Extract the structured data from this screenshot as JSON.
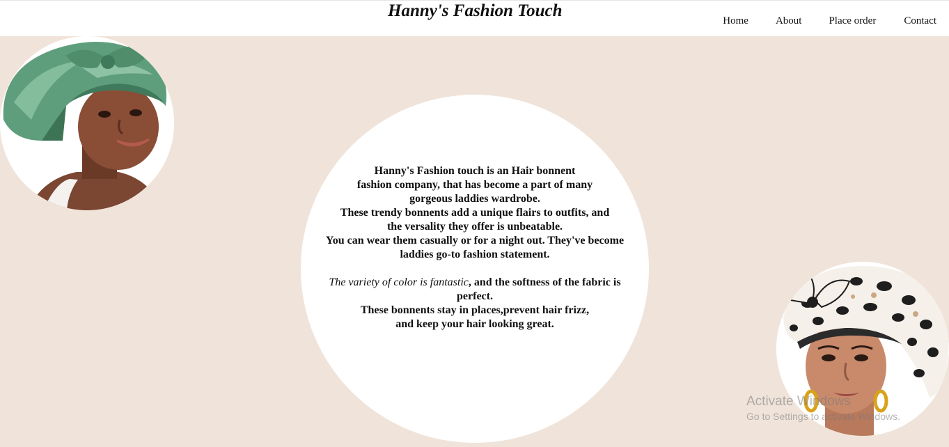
{
  "header": {
    "brand": "Hanny's Fashion Touch",
    "nav": {
      "home": "Home",
      "about": "About",
      "place_order": "Place order",
      "contact": "Contact"
    }
  },
  "about": {
    "lines_1": [
      "Hanny's Fashion touch is an Hair bonnent",
      "fashion company, that has become a part of many",
      "gorgeous laddies wardrobe.",
      "These trendy bonnents add a unique flairs to outfits, and",
      "the versality they offer is unbeatable.",
      "You can wear them casually or for a night out. They've become",
      "laddies go-to fashion statement."
    ],
    "italic_part": "The variety of color is fantastic",
    "after_italic": ", and the softness of the fabric is",
    "lines_2": [
      "perfect.",
      "These bonnents stay in places,prevent hair frizz,",
      "and keep your hair looking great."
    ]
  },
  "images": {
    "left_icon": "woman-green-satin-bonnet-photo",
    "right_icon": "woman-leopard-print-bonnet-photo"
  },
  "watermark": {
    "title": "Activate Windows",
    "subtitle": "Go to Settings to activate Windows."
  },
  "colors": {
    "page_background": "#f0e4da",
    "header_background": "#ffffff",
    "text": "#111111"
  }
}
